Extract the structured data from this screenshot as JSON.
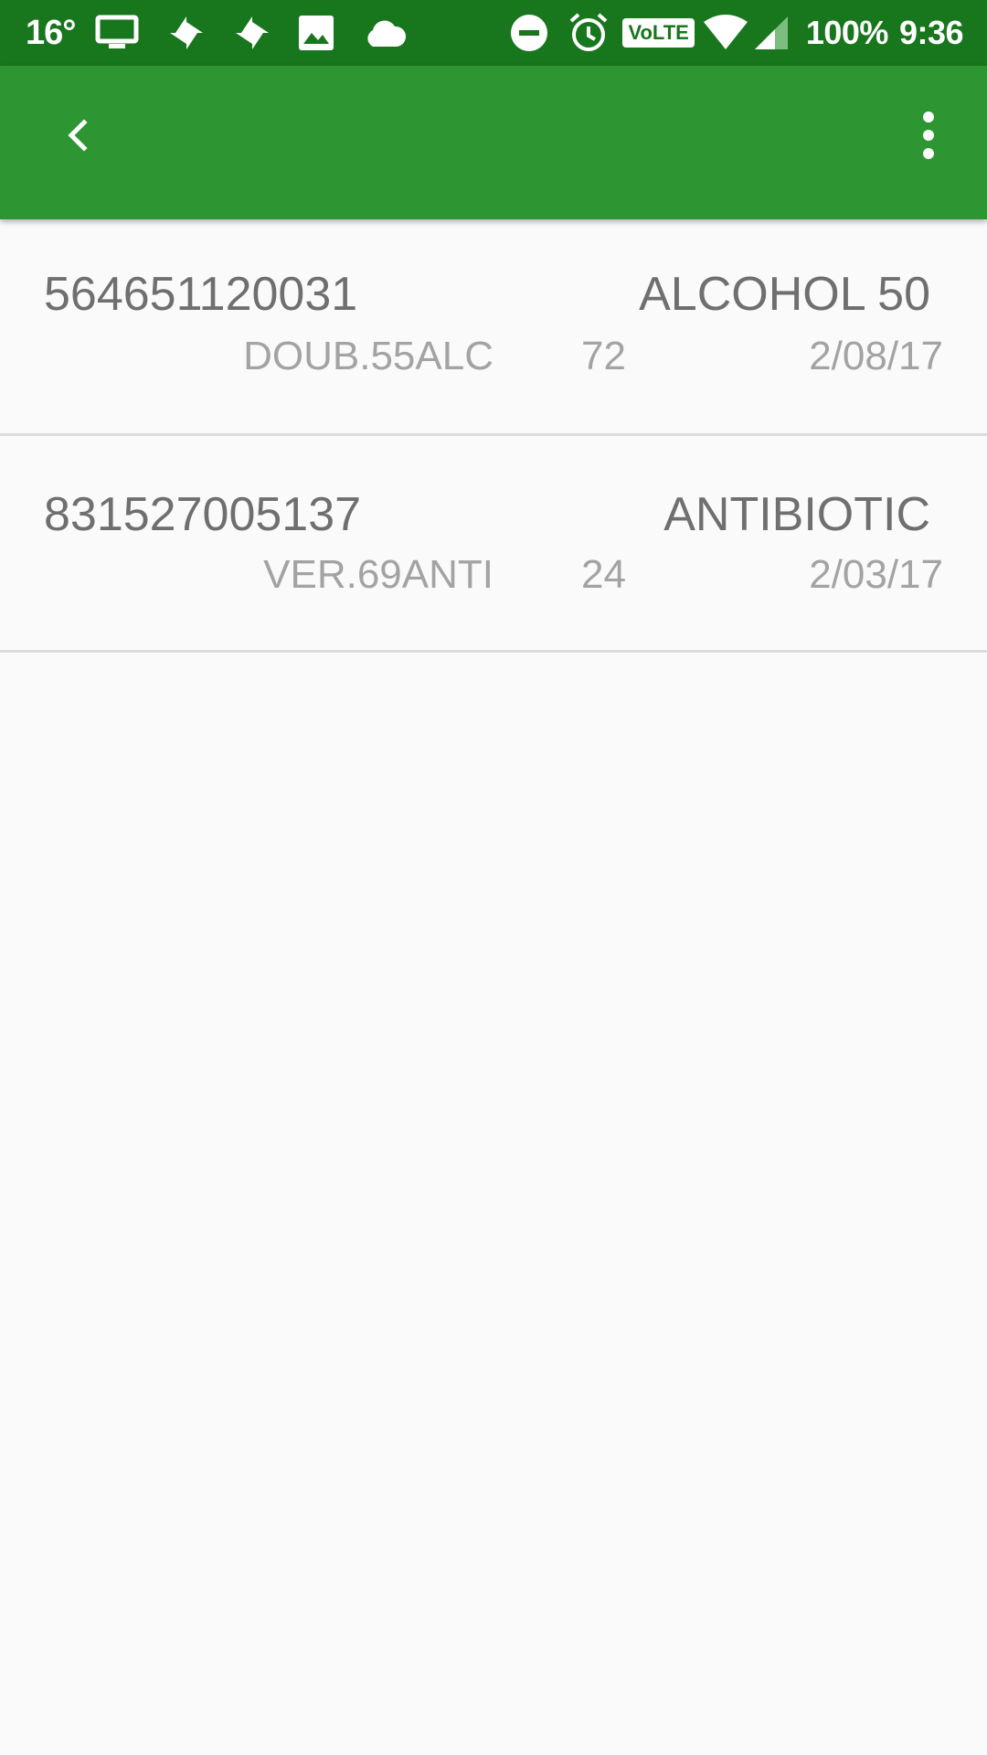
{
  "status_bar": {
    "temperature": "16°",
    "battery": "100%",
    "time": "9:36",
    "volte_label": "VoLTE",
    "left_icons": [
      "tv-icon",
      "pinwheel-icon",
      "pinwheel-icon",
      "image-icon",
      "cloud-icon"
    ],
    "right_icons": [
      "do-not-disturb-icon",
      "alarm-icon",
      "volte-icon",
      "wifi-icon",
      "signal-icon"
    ]
  },
  "app_bar": {
    "back_icon": "chevron-left-icon",
    "menu_icon": "more-vert-icon",
    "background": "#2d9633"
  },
  "items": [
    {
      "code": "564651120031",
      "name": "ALCOHOL 50",
      "ref": "DOUB.55ALC",
      "qty": "72",
      "date": "2/08/17"
    },
    {
      "code": "831527005137",
      "name": "ANTIBIOTIC",
      "ref": "VER.69ANTI",
      "qty": "24",
      "date": "2/03/17"
    }
  ],
  "colors": {
    "status_bar": "#18761d",
    "primary": "#2d9633",
    "background": "#fafafa",
    "text_primary": "#6f6f6f",
    "text_secondary": "#a3a3a3",
    "divider": "#dcdcdc"
  }
}
